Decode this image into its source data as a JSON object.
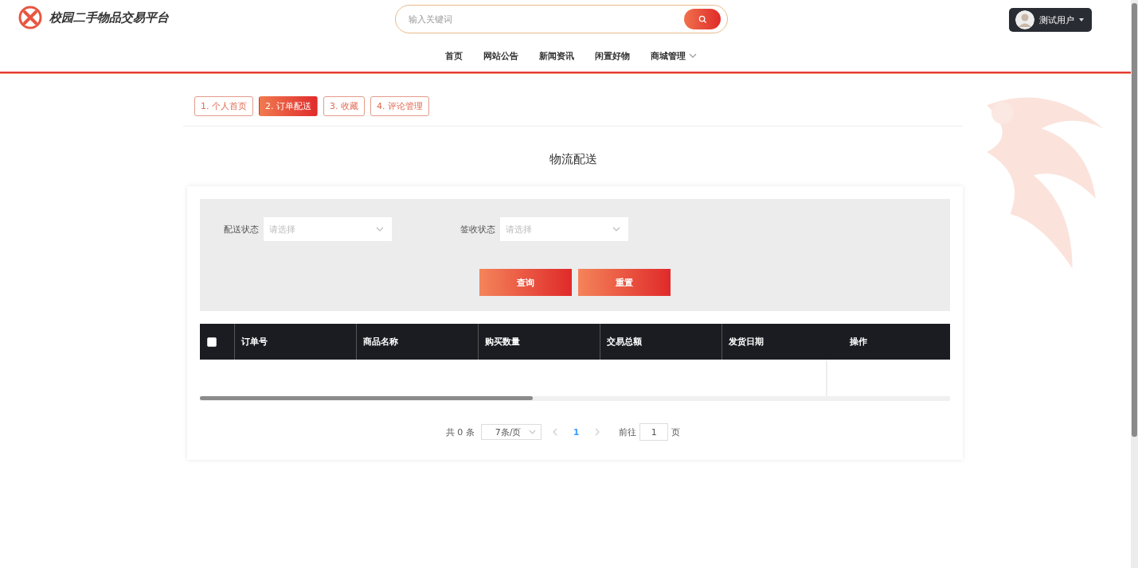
{
  "header": {
    "site_title": "校园二手物品交易平台",
    "search": {
      "placeholder": "输入关键词"
    },
    "user": {
      "name": "测试用户"
    }
  },
  "nav": [
    {
      "label": "首页",
      "dropdown": false
    },
    {
      "label": "网站公告",
      "dropdown": false
    },
    {
      "label": "新闻资讯",
      "dropdown": false
    },
    {
      "label": "闲置好物",
      "dropdown": false
    },
    {
      "label": "商城管理",
      "dropdown": true
    }
  ],
  "tabs": [
    {
      "label": "1. 个人首页",
      "selected": false
    },
    {
      "label": "2. 订单配送",
      "selected": true
    },
    {
      "label": "3. 收藏",
      "selected": false
    },
    {
      "label": "4. 评论管理",
      "selected": false
    }
  ],
  "page_title": "物流配送",
  "filters": [
    {
      "label": "配送状态",
      "placeholder": "请选择"
    },
    {
      "label": "签收状态",
      "placeholder": "请选择"
    }
  ],
  "buttons": [
    "查询",
    "重置"
  ],
  "table": {
    "select_all": {
      "checked": false
    },
    "columns": [
      "订单号",
      "商品名称",
      "购买数量",
      "交易总额",
      "发货日期",
      "操作"
    ]
  },
  "pagination": {
    "total": "共 0 条",
    "page_size": "7条/页",
    "pages": [
      {
        "label": "1",
        "selected": true
      }
    ],
    "goto_label": "前往",
    "goto_value": "1",
    "goto_suffix": "页"
  }
}
